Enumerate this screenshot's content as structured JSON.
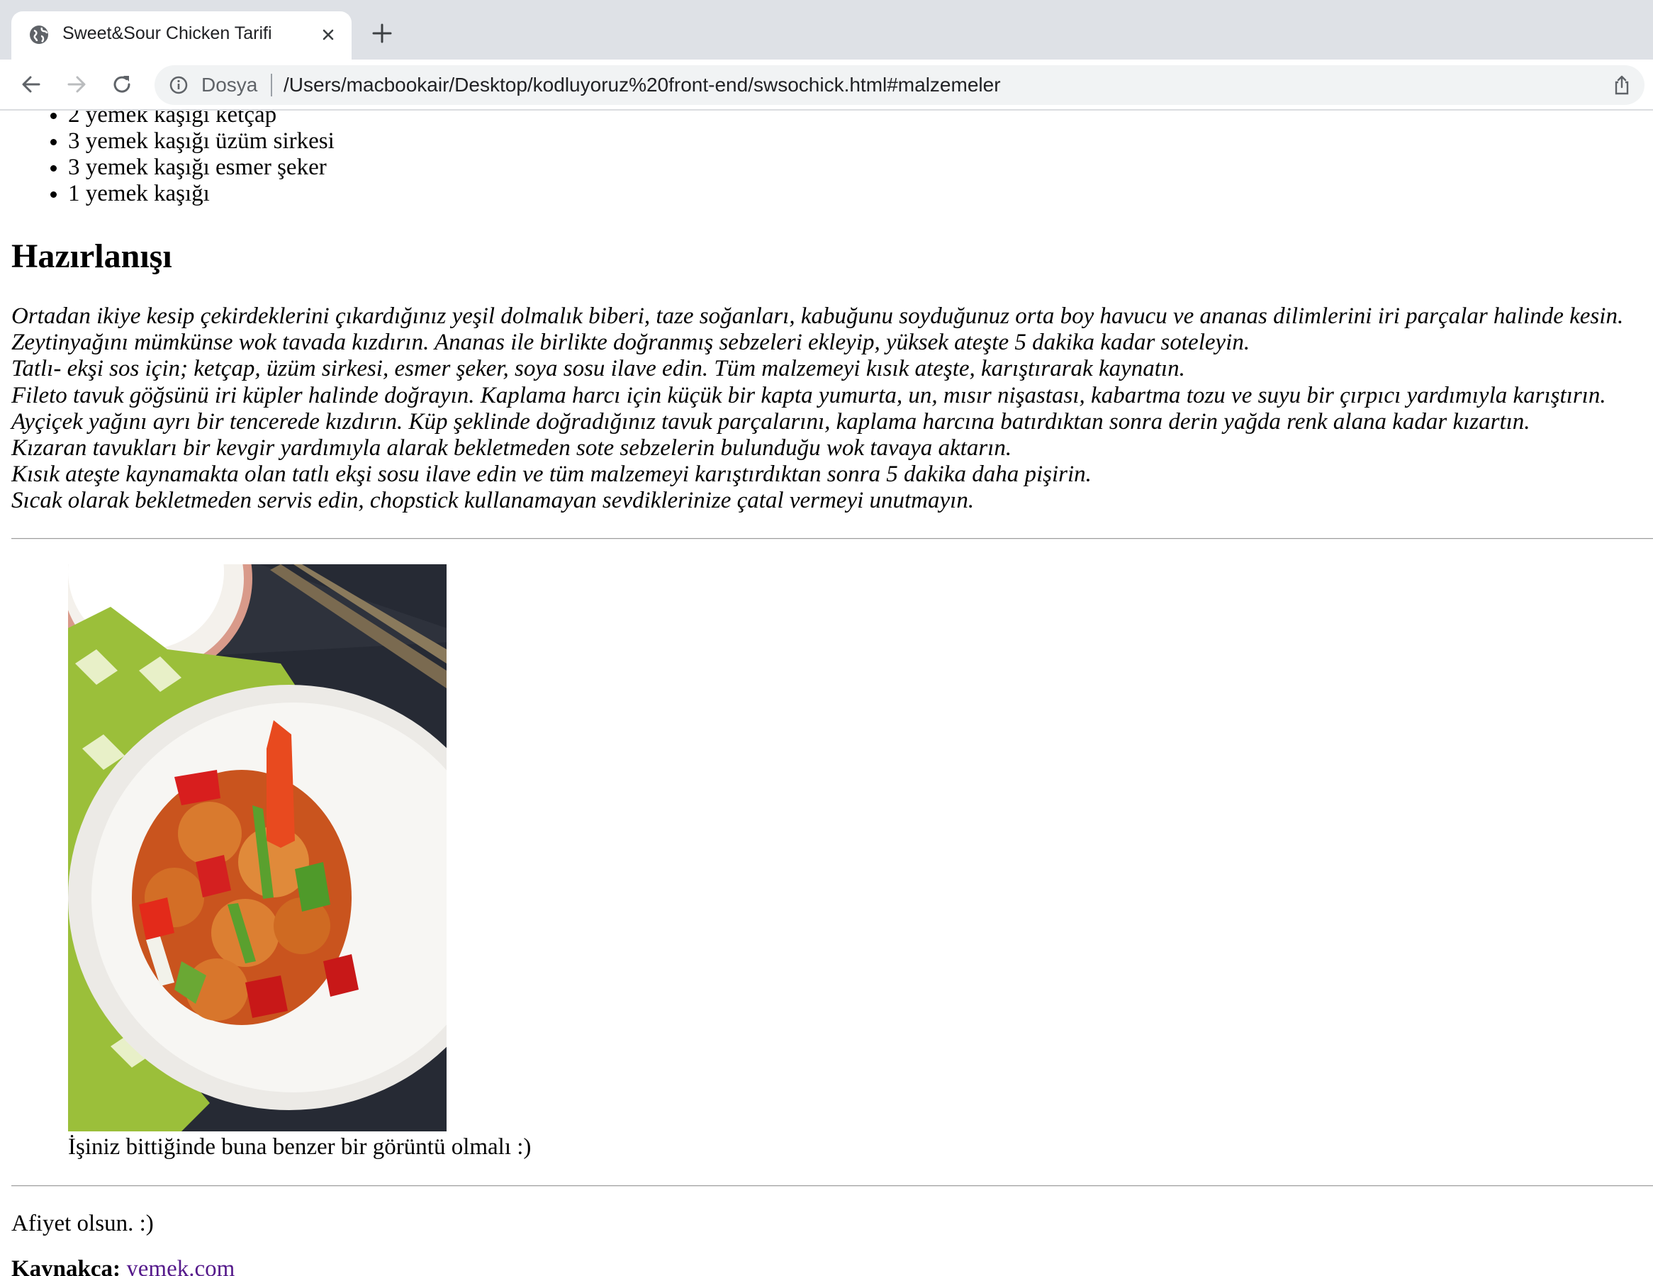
{
  "browser": {
    "tab_title": "Sweet&Sour Chicken Tarifi",
    "chip_label": "Dosya",
    "url": "/Users/macbookair/Desktop/kodluyoruz%20front-end/swsochick.html#malzemeler",
    "icons": [
      "globe-icon",
      "close-icon",
      "plus-icon",
      "back-arrow-icon",
      "forward-arrow-icon",
      "reload-icon",
      "info-icon",
      "share-icon"
    ]
  },
  "page": {
    "ingredients": [
      "2 yemek kaşığı ketçap",
      "3 yemek kaşığı üzüm sirkesi",
      "3 yemek kaşığı esmer şeker",
      "1 yemek kaşığı"
    ],
    "heading": "Hazırlanışı",
    "steps": [
      "Ortadan ikiye kesip çekirdeklerini çıkardığınız yeşil dolmalık biberi, taze soğanları, kabuğunu soyduğunuz orta boy havucu ve ananas dilimlerini iri parçalar halinde kesin.",
      "Zeytinyağını mümkünse wok tavada kızdırın. Ananas ile birlikte doğranmış sebzeleri ekleyip, yüksek ateşte 5 dakika kadar soteleyin.",
      "Tatlı- ekşi sos için; ketçap, üzüm sirkesi, esmer şeker, soya sosu ilave edin. Tüm malzemeyi kısık ateşte, karıştırarak kaynatın.",
      "Fileto tavuk göğsünü iri küpler halinde doğrayın. Kaplama harcı için küçük bir kapta yumurta, un, mısır nişastası, kabartma tozu ve suyu bir çırpıcı yardımıyla karıştırın.",
      "Ayçiçek yağını ayrı bir tencerede kızdırın. Küp şeklinde doğradığınız tavuk parçalarını, kaplama harcına batırdıktan sonra derin yağda renk alana kadar kızartın.",
      "Kızaran tavukları bir kevgir yardımıyla alarak bekletmeden sote sebzelerin bulunduğu wok tavaya aktarın.",
      "Kısık ateşte kaynamakta olan tatlı ekşi sosu ilave edin ve tüm malzemeyi karıştırdıktan sonra 5 dakika daha pişirin.",
      "Sıcak olarak bekletmeden servis edin, chopstick kullanamayan sevdiklerinize çatal vermeyi unutmayın."
    ],
    "caption": "İşiniz bittiğinde buna benzer bir görüntü olmalı :)",
    "closing": "Afiyet olsun. :)",
    "source_label": "Kaynakça:",
    "source_link": "yemek.com"
  }
}
